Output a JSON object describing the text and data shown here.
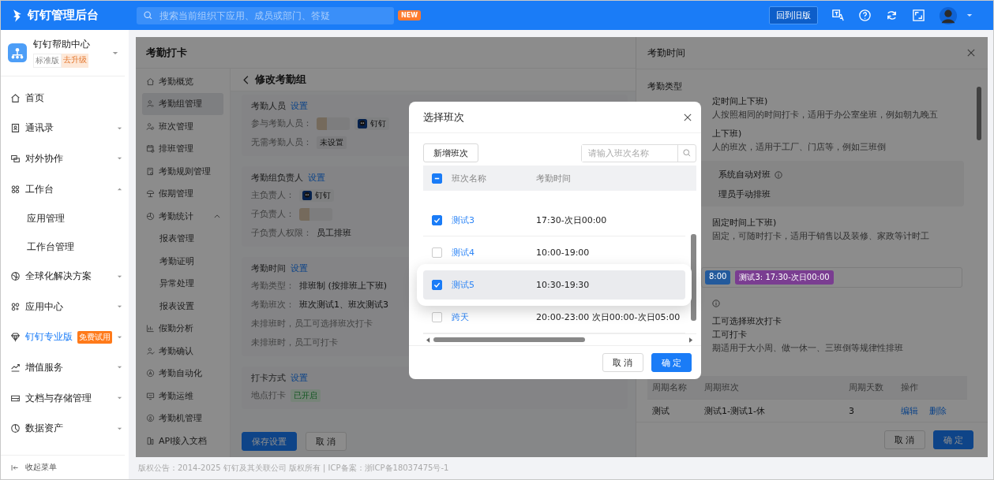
{
  "topbar": {
    "title": "钉钉管理后台",
    "search_placeholder": "搜索当前组织下应用、成员或部门、答疑",
    "new_badge": "NEW",
    "old_version_button": "回到旧版"
  },
  "sidebar": {
    "org": {
      "name": "钉钉帮助中心",
      "edition": "标准版",
      "upgrade": "去升级"
    },
    "items": [
      {
        "label": "首页",
        "promoted": false
      },
      {
        "label": "通讯录",
        "expanded": false,
        "promoted": false
      },
      {
        "label": "对外协作",
        "expanded": false,
        "promoted": false
      },
      {
        "label": "工作台",
        "expanded": true,
        "promoted": false,
        "children": [
          {
            "label": "应用管理"
          },
          {
            "label": "工作台管理"
          }
        ]
      },
      {
        "label": "全球化解决方案",
        "expanded": false,
        "promoted": false
      },
      {
        "label": "应用中心",
        "expanded": false,
        "promoted": false
      },
      {
        "label": "钉钉专业版",
        "expanded": false,
        "promoted": true,
        "badge": "免费试用"
      },
      {
        "label": "增值服务",
        "expanded": false,
        "promoted": false
      },
      {
        "label": "文档与存储管理",
        "expanded": false,
        "promoted": false
      },
      {
        "label": "数据资产",
        "expanded": false,
        "promoted": false
      }
    ],
    "collapse": "收起菜单"
  },
  "page": {
    "title": "考勤打卡",
    "subnav": [
      {
        "label": "考勤概览",
        "selected": false
      },
      {
        "label": "考勤组管理",
        "selected": true
      },
      {
        "label": "班次管理",
        "selected": false
      },
      {
        "label": "排班管理",
        "selected": false
      },
      {
        "label": "考勤规则管理",
        "selected": false
      },
      {
        "label": "假期管理",
        "selected": false
      },
      {
        "label": "考勤统计",
        "selected": false,
        "expanded": true,
        "children": [
          {
            "label": "报表管理",
            "selected": false
          },
          {
            "label": "考勤证明",
            "selected": false
          },
          {
            "label": "异常处理",
            "selected": false
          },
          {
            "label": "报表设置",
            "selected": false
          }
        ]
      },
      {
        "label": "假勤分析",
        "selected": false
      },
      {
        "label": "考勤确认",
        "selected": false
      },
      {
        "label": "考勤自动化",
        "selected": false
      },
      {
        "label": "考勤运维",
        "selected": false
      },
      {
        "label": "考勤机管理",
        "selected": false
      },
      {
        "label": "API接入文档",
        "selected": false
      }
    ],
    "form": {
      "title": "修改考勤组",
      "sections": [
        {
          "title": "考勤人员",
          "action": "设置",
          "rows": [
            {
              "label": "参与考勤人员：",
              "values": [
                {
                  "kind": "redacted"
                },
                {
                  "kind": "person",
                  "name": "钉钉"
                }
              ]
            },
            {
              "label": "无需考勤人员：",
              "values": [
                {
                  "kind": "tag",
                  "text": "未设置"
                }
              ]
            }
          ]
        },
        {
          "title": "考勤组负责人",
          "action": "设置",
          "rows": [
            {
              "label": "主负责人：",
              "values": [
                {
                  "kind": "person",
                  "name": "钉钉"
                }
              ]
            },
            {
              "label": "子负责人：",
              "values": [
                {
                  "kind": "redacted"
                }
              ]
            },
            {
              "label": "子负责人权限：",
              "values": [
                {
                  "kind": "text",
                  "text": "员工排班"
                }
              ]
            }
          ]
        },
        {
          "title": "考勤时间",
          "action": "设置",
          "rows": [
            {
              "label": "考勤类型：",
              "values": [
                {
                  "kind": "text",
                  "text": "排班制 (按排班上下班)"
                }
              ]
            },
            {
              "label": "考勤班次：",
              "values": [
                {
                  "kind": "text",
                  "text": "班次测试1、班次测试3"
                }
              ]
            },
            {
              "label": "未排班时，员工可选择班次打卡"
            },
            {
              "label": "未排班时，员工可打卡"
            }
          ]
        },
        {
          "title": "打卡方式",
          "action": "设置",
          "rows": [
            {
              "label": "地点打卡",
              "values": [
                {
                  "kind": "status",
                  "text": "已开启"
                }
              ]
            }
          ]
        }
      ],
      "save_button": "保存设置",
      "cancel_button": "取 消"
    }
  },
  "drawer": {
    "title": "考勤时间",
    "type_label": "考勤类型",
    "lines": [
      {
        "kind": "option",
        "text": "定时间上下班)"
      },
      {
        "kind": "hint",
        "text": "人按照相同的时间打卡，适用于办公室坐班，例如朝九晚五"
      },
      {
        "kind": "option",
        "text": "上下班)"
      },
      {
        "kind": "hint",
        "text": "人的班次，适用于工厂、门店等，例如三班倒"
      },
      {
        "kind": "panel",
        "items": [
          {
            "text": "系统自动对班",
            "info": true
          },
          {
            "text": "理员手动排班",
            "info": false
          }
        ]
      },
      {
        "kind": "option",
        "text": "固定时间上下班)"
      },
      {
        "kind": "hint",
        "text": "固定，可随时打卡，适用于销售以及装修、家政等计时工"
      },
      {
        "kind": "tags",
        "tags": [
          {
            "text": "8:00",
            "color": "#235a9c"
          },
          {
            "text": "测试3: 17:30-次日00:00",
            "color": "#7a3d91"
          }
        ]
      },
      {
        "kind": "info"
      },
      {
        "kind": "text",
        "text": "工可选择班次打卡"
      },
      {
        "kind": "text",
        "text": "工可打卡"
      },
      {
        "kind": "hint",
        "text": "期适用于大小周、做一休一、三班倒等规律性排班"
      }
    ],
    "cycle_table": {
      "columns": [
        "周期名称",
        "周期班次",
        "周期天数",
        "操作"
      ],
      "rows": [
        {
          "name": "测试",
          "shifts": "测试1-测试1-休",
          "days": "3",
          "actions": [
            "编辑",
            "删除"
          ]
        }
      ]
    },
    "cancel_button": "取 消",
    "ok_button": "确 定"
  },
  "modal": {
    "title": "选择班次",
    "add_button": "新增班次",
    "search_placeholder": "请输入班次名称",
    "select_all_indeterminate": true,
    "columns": [
      "班次名称",
      "考勤时间"
    ],
    "rows": [
      {
        "name": "测试3",
        "time": "17:30-次日00:00",
        "checked": true,
        "highlighted": false
      },
      {
        "name": "测试4",
        "time": "10:00-19:00",
        "checked": false,
        "highlighted": false
      },
      {
        "name": "测试5",
        "time": "10:30-19:30",
        "checked": true,
        "highlighted": true
      },
      {
        "name": "跨天",
        "time": "20:00-23:00 次日00:00-次日05:00",
        "checked": false,
        "highlighted": false
      }
    ],
    "cancel_button": "取 消",
    "ok_button": "确 定"
  },
  "footer": "版权公告：2014-2025 钉钉及其关联公司 版权所有 | ICP备案：浙ICP备18037475号-1"
}
